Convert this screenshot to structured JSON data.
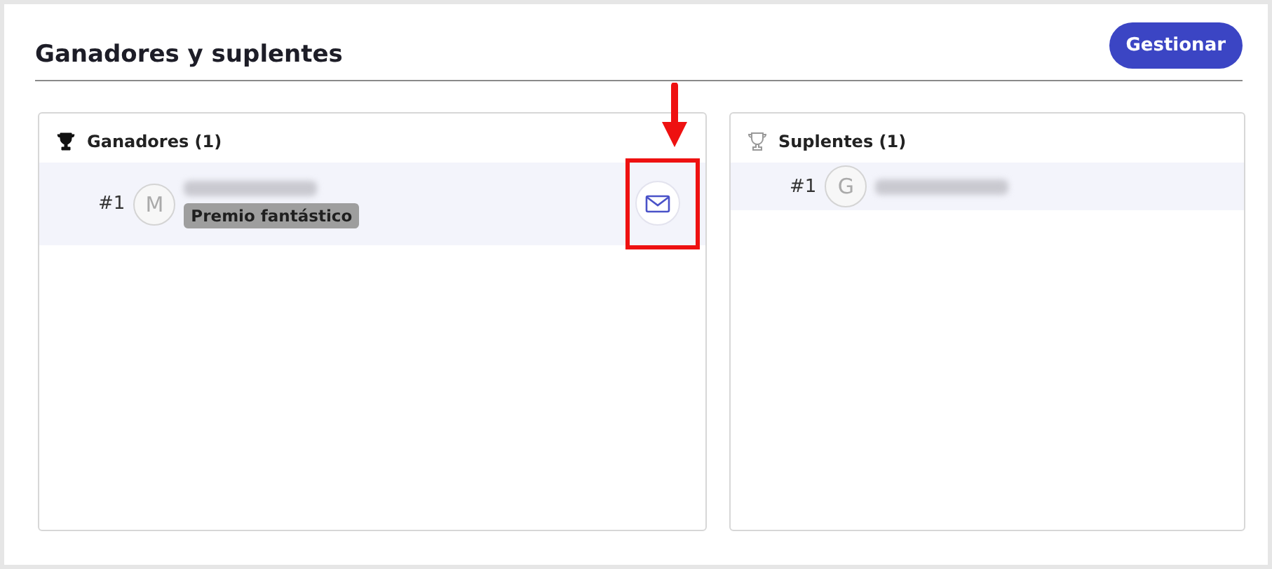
{
  "title": "Ganadores y suplentes",
  "manage_button": "Gestionar",
  "panels": [
    {
      "kind": "winners",
      "heading": "Ganadores (1)",
      "entries": [
        {
          "rank": "#1",
          "initial": "M",
          "prize": "Premio fantástico",
          "annotated": true
        }
      ]
    },
    {
      "kind": "substitutes",
      "heading": "Suplentes (1)",
      "entries": [
        {
          "rank": "#1",
          "initial": "G"
        }
      ]
    }
  ]
}
